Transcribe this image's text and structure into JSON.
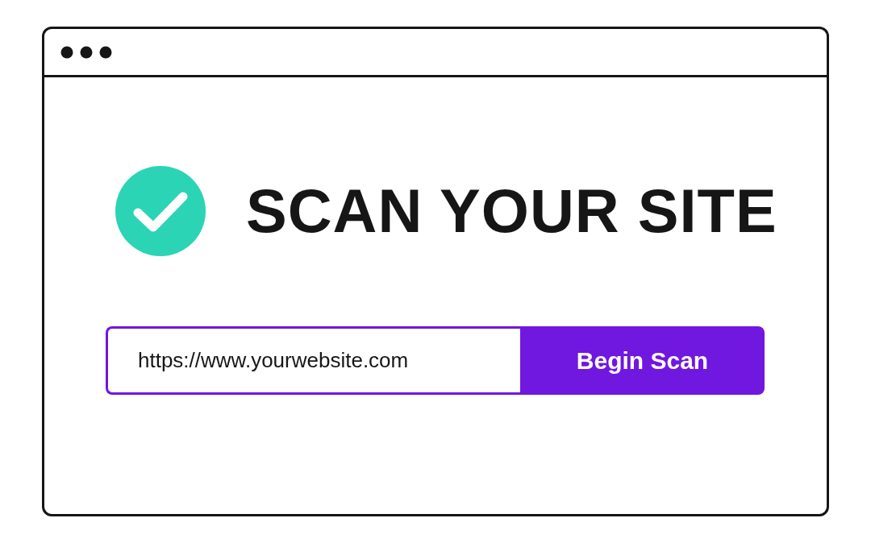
{
  "heading": "SCAN YOUR SITE",
  "scan_form": {
    "url_value": "https://www.yourwebsite.com",
    "button": "Begin Scan"
  }
}
